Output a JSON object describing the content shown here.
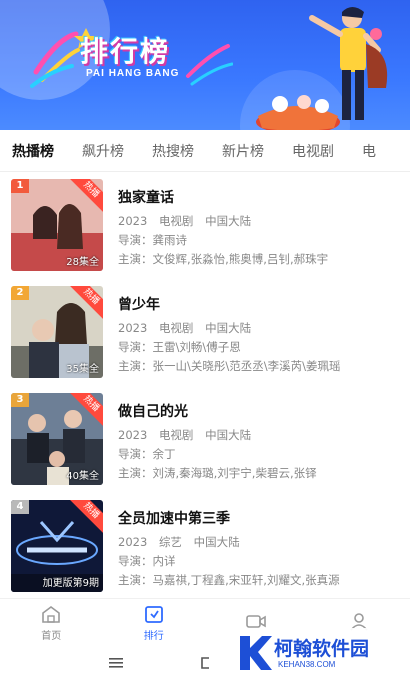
{
  "banner": {
    "title": "排行榜",
    "subtitle": "PAI HANG BANG"
  },
  "tabs": [
    {
      "label": "热播榜",
      "active": true
    },
    {
      "label": "飙升榜",
      "active": false
    },
    {
      "label": "热搜榜",
      "active": false
    },
    {
      "label": "新片榜",
      "active": false
    },
    {
      "label": "电视剧",
      "active": false
    },
    {
      "label": "电",
      "active": false
    }
  ],
  "items": [
    {
      "rank": "1",
      "rank_color": "#f25a3c",
      "hot": "热播",
      "episodes": "28集全",
      "poster_colors": [
        "#e7b8b0",
        "#c54a4a"
      ],
      "title": "独家童话",
      "year": "2023",
      "genre": "电视剧",
      "region": "中国大陆",
      "director": "导演：龚雨诗",
      "cast": "主演：文俊辉,张淼怡,熊奥博,吕钊,郝珠宇"
    },
    {
      "rank": "2",
      "rank_color": "#f2a735",
      "hot": "热播",
      "episodes": "35集全",
      "poster_colors": [
        "#d8d4c6",
        "#6d6e66"
      ],
      "title": "曾少年",
      "year": "2023",
      "genre": "电视剧",
      "region": "中国大陆",
      "director": "导演：王雷\\刘畅\\傅子恩",
      "cast": "主演：张一山\\关晓彤\\范丞丞\\李溪芮\\姜珮瑶"
    },
    {
      "rank": "3",
      "rank_color": "#e9a53a",
      "hot": "热播",
      "episodes": "40集全",
      "poster_colors": [
        "#6d7f96",
        "#2f3642"
      ],
      "title": "做自己的光",
      "year": "2023",
      "genre": "电视剧",
      "region": "中国大陆",
      "director": "导演：余丁",
      "cast": "主演：刘涛,秦海璐,刘宇宁,柴碧云,张铎"
    },
    {
      "rank": "4",
      "rank_color": "#b9b9b9",
      "hot": "热播",
      "episodes": "加更版第9期",
      "poster_colors": [
        "#12204a",
        "#0a0f22"
      ],
      "title": "全员加速中第三季",
      "year": "2023",
      "genre": "综艺",
      "region": "中国大陆",
      "director": "导演：内详",
      "cast": "主演：马嘉祺,丁程鑫,宋亚轩,刘耀文,张真源"
    }
  ],
  "nav": [
    {
      "label": "首页",
      "icon": "home-icon",
      "active": false
    },
    {
      "label": "排行",
      "icon": "ranking-icon",
      "active": true
    },
    {
      "label": "",
      "icon": "video-icon",
      "active": false
    },
    {
      "label": "",
      "icon": "user-icon",
      "active": false
    }
  ],
  "watermark": {
    "text": "柯翰软件园",
    "url": "KEHAN38.COM"
  },
  "colors": {
    "accent": "#2f6bff",
    "banner": "#3a78ff",
    "hot": "#ff4a3d"
  }
}
